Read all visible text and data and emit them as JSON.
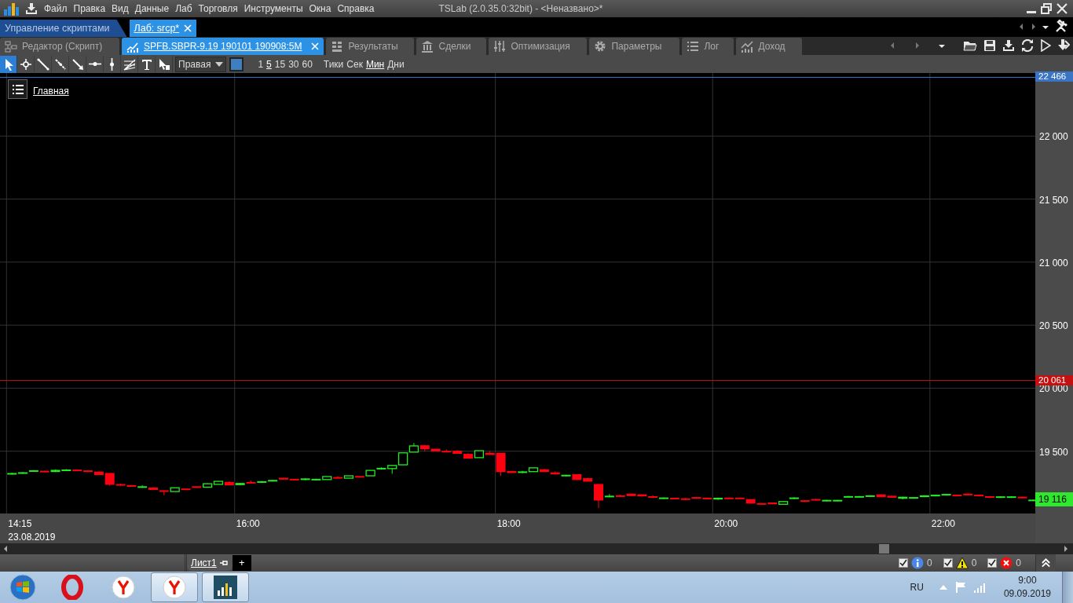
{
  "window": {
    "title": "TSLab (2.0.35.0:32bit) - <Неназвано>*"
  },
  "menu": [
    "Файл",
    "Правка",
    "Вид",
    "Данные",
    "Лаб",
    "Торговля",
    "Инструменты",
    "Окна",
    "Справка"
  ],
  "doc_tabs": [
    {
      "label": "Управление скриптами",
      "selected": false
    },
    {
      "label": "Лаб: srcp*",
      "selected": true
    }
  ],
  "view_tabs": [
    {
      "kind": "editor",
      "label": "Редактор (Скрипт)",
      "selected": false
    },
    {
      "kind": "chart",
      "label": "SPFB.SBPR-9.19 190101 190908:5M",
      "selected": true
    },
    {
      "kind": "results",
      "label": "Результаты",
      "selected": false
    },
    {
      "kind": "deals",
      "label": "Сделки",
      "selected": false
    },
    {
      "kind": "optimization",
      "label": "Оптимизация",
      "selected": false
    },
    {
      "kind": "parameters",
      "label": "Параметры",
      "selected": false
    },
    {
      "kind": "log",
      "label": "Лог",
      "selected": false
    },
    {
      "kind": "income",
      "label": "Доход",
      "selected": false
    }
  ],
  "toolbar": {
    "tools": [
      {
        "kind": "pointer",
        "selected": true
      },
      {
        "kind": "cross",
        "selected": false
      },
      {
        "kind": "line",
        "selected": false
      },
      {
        "kind": "dotted-line",
        "selected": false
      },
      {
        "kind": "arrow-line",
        "selected": false
      },
      {
        "kind": "horizontal-line",
        "selected": false
      },
      {
        "kind": "vertical-line",
        "selected": false
      },
      {
        "kind": "fan",
        "selected": false
      },
      {
        "kind": "text",
        "selected": false
      },
      {
        "kind": "delete",
        "selected": false
      }
    ],
    "axis_side": "Правая",
    "intervals": [
      {
        "label": "1",
        "selected": false
      },
      {
        "label": "5",
        "selected": true
      },
      {
        "label": "15",
        "selected": false
      },
      {
        "label": "30",
        "selected": false
      },
      {
        "label": "60",
        "selected": false
      }
    ],
    "units": [
      {
        "label": "Тики",
        "selected": false
      },
      {
        "label": "Сек",
        "selected": false
      },
      {
        "label": "Мин",
        "selected": true
      },
      {
        "label": "Дни",
        "selected": false
      }
    ]
  },
  "chart": {
    "pane_label": "Главная",
    "level_tags": [
      {
        "label": "22 466",
        "color": "#3b74c4"
      },
      {
        "label": "20 061",
        "color": "#c41010"
      }
    ],
    "price_labels": [
      "22 000",
      "21 500",
      "21 000",
      "20 500",
      "20 000",
      "19 500"
    ],
    "last_price": "19 116",
    "time_labels": [
      "14:15",
      "16:00",
      "18:00",
      "20:00",
      "22:00"
    ],
    "date_label": "23.08.2019"
  },
  "sheet_tab": {
    "label": "Лист1",
    "add": "+"
  },
  "filters": [
    {
      "kind": "info",
      "checked": true,
      "count": "0"
    },
    {
      "kind": "warning",
      "checked": true,
      "count": "0"
    },
    {
      "kind": "error",
      "checked": true,
      "count": "0"
    }
  ],
  "taskbar": {
    "apps": [
      {
        "kind": "opera",
        "active": false
      },
      {
        "kind": "yandex",
        "active": false
      },
      {
        "kind": "yandex",
        "active": true
      },
      {
        "kind": "tslab",
        "active": true
      }
    ],
    "language": "RU",
    "time": "9:00",
    "date": "09.09.2019"
  }
}
